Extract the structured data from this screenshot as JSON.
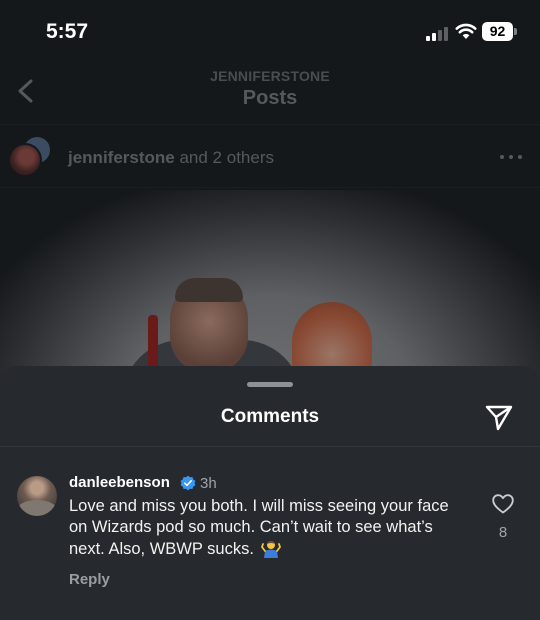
{
  "status_bar": {
    "time": "5:57",
    "battery": "92",
    "icons": [
      "signal-icon",
      "wifi-icon",
      "battery-icon"
    ]
  },
  "nav": {
    "username": "JENNIFERSTONE",
    "title": "Posts",
    "back_icon": "chevron-left-icon"
  },
  "post": {
    "author": "jenniferstone",
    "author_suffix": " and 2 others",
    "more_icon": "more-horizontal-icon"
  },
  "comments_sheet": {
    "title": "Comments",
    "share_icon": "send-icon",
    "comments": [
      {
        "username": "danleebenson",
        "verified": true,
        "time": "3h",
        "text": "Love and miss you both. I will miss seeing your face on Wizards pod so much. Can’t wait to see what’s next. Also, WBWP sucks.",
        "emoji": "person-shrugging",
        "reply_label": "Reply",
        "like_count": "8"
      }
    ]
  },
  "colors": {
    "sheet_background": "#26292d",
    "backdrop": "#15181b",
    "verified_blue": "#3897f0"
  }
}
